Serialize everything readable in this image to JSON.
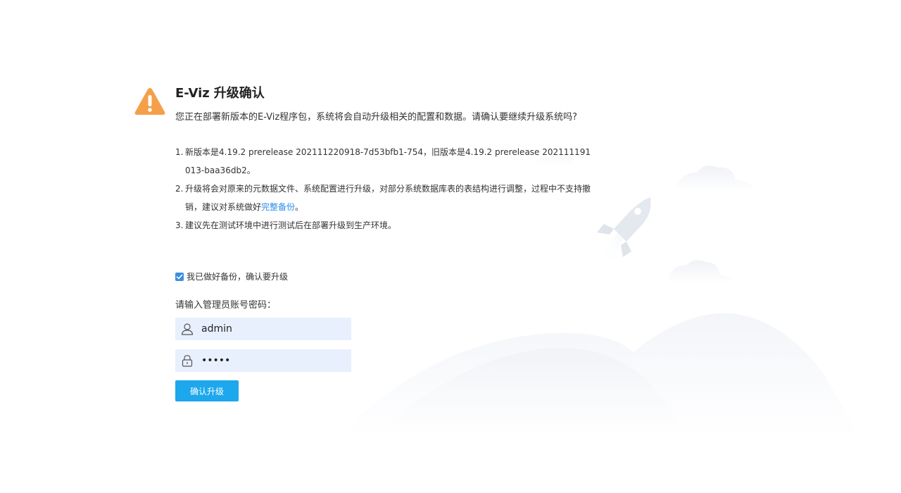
{
  "dialog": {
    "title_product": "E-Viz",
    "title_action": "升级确认",
    "description": "您正在部署新版本的E-Viz程序包，系统将会自动升级相关的配置和数据。请确认要继续升级系统吗?",
    "notes": [
      {
        "num": "1.",
        "text": "新版本是4.19.2 prerelease 202111220918-7d53bfb1-754，旧版本是4.19.2 prerelease 202111191013-baa36db2。"
      },
      {
        "num": "2.",
        "text_before": "升级将会对原来的元数据文件、系统配置进行升级，对部分系统数据库表的表结构进行调整，过程中不支持撤销，建议对系统做好",
        "link": "完整备份",
        "text_after": "。"
      },
      {
        "num": "3.",
        "text": "建议先在测试环境中进行测试后在部署升级到生产环境。"
      }
    ],
    "confirm_checkbox": {
      "label": "我已做好备份，确认要升级",
      "checked": true
    },
    "credentials_prompt": "请输入管理员账号密码：",
    "username": {
      "value": "admin",
      "icon": "user-icon"
    },
    "password": {
      "value": "admin",
      "icon": "lock-icon"
    },
    "submit_label": "确认升级"
  },
  "colors": {
    "warning": "#f4a04a",
    "accent": "#1da7ec",
    "link": "#2b8fe8",
    "field_bg": "#e8f0fd"
  }
}
